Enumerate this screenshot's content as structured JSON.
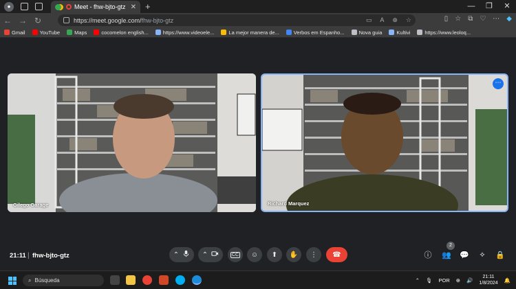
{
  "browser": {
    "tab_title": "Meet - fhw-bjto-gtz",
    "url_host": "https://meet.google.com/",
    "url_path": "fhw-bjto-gtz",
    "bookmarks": [
      {
        "label": "Gmail",
        "color": "#ea4335"
      },
      {
        "label": "YouTube",
        "color": "#ff0000"
      },
      {
        "label": "Maps",
        "color": "#34a853"
      },
      {
        "label": "cocomelon english...",
        "color": "#ff0000"
      },
      {
        "label": "https://www.videoele...",
        "color": "#8ab4f8"
      },
      {
        "label": "La mejor manera de...",
        "color": "#fbbc04"
      },
      {
        "label": "Verbos em Espanho...",
        "color": "#4285f4"
      },
      {
        "label": "Nova guia",
        "color": "#bdc1c6"
      },
      {
        "label": "Kultivi",
        "color": "#8ab4f8"
      },
      {
        "label": "https://www.leoloq...",
        "color": "#bdc1c6"
      }
    ]
  },
  "meeting": {
    "participants": [
      {
        "name": "Gilego Garage"
      },
      {
        "name": "Richard Marquez"
      }
    ],
    "time": "21:11",
    "separator": "|",
    "code": "fhw-bjto-gtz",
    "people_count": "2"
  },
  "taskbar": {
    "search_label": "Búsqueda",
    "language": "POR",
    "time": "21:11",
    "date": "1/8/2024"
  },
  "colors": {
    "accent": "#8ab4f8",
    "end_call": "#ea4335",
    "meet_bg": "#202124"
  }
}
